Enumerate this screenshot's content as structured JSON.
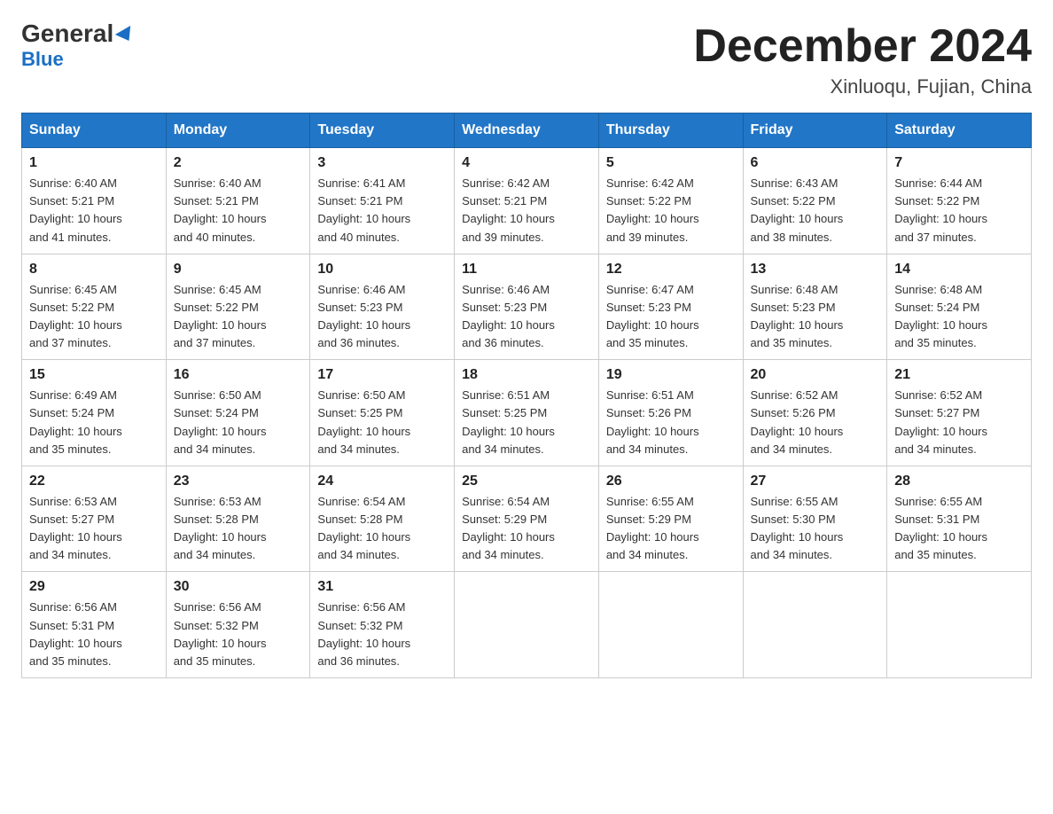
{
  "header": {
    "logo_main": "General",
    "logo_sub": "Blue",
    "month_title": "December 2024",
    "location": "Xinluoqu, Fujian, China"
  },
  "days_of_week": [
    "Sunday",
    "Monday",
    "Tuesday",
    "Wednesday",
    "Thursday",
    "Friday",
    "Saturday"
  ],
  "weeks": [
    [
      {
        "day": "1",
        "sunrise": "6:40 AM",
        "sunset": "5:21 PM",
        "daylight": "10 hours and 41 minutes."
      },
      {
        "day": "2",
        "sunrise": "6:40 AM",
        "sunset": "5:21 PM",
        "daylight": "10 hours and 40 minutes."
      },
      {
        "day": "3",
        "sunrise": "6:41 AM",
        "sunset": "5:21 PM",
        "daylight": "10 hours and 40 minutes."
      },
      {
        "day": "4",
        "sunrise": "6:42 AM",
        "sunset": "5:21 PM",
        "daylight": "10 hours and 39 minutes."
      },
      {
        "day": "5",
        "sunrise": "6:42 AM",
        "sunset": "5:22 PM",
        "daylight": "10 hours and 39 minutes."
      },
      {
        "day": "6",
        "sunrise": "6:43 AM",
        "sunset": "5:22 PM",
        "daylight": "10 hours and 38 minutes."
      },
      {
        "day": "7",
        "sunrise": "6:44 AM",
        "sunset": "5:22 PM",
        "daylight": "10 hours and 37 minutes."
      }
    ],
    [
      {
        "day": "8",
        "sunrise": "6:45 AM",
        "sunset": "5:22 PM",
        "daylight": "10 hours and 37 minutes."
      },
      {
        "day": "9",
        "sunrise": "6:45 AM",
        "sunset": "5:22 PM",
        "daylight": "10 hours and 37 minutes."
      },
      {
        "day": "10",
        "sunrise": "6:46 AM",
        "sunset": "5:23 PM",
        "daylight": "10 hours and 36 minutes."
      },
      {
        "day": "11",
        "sunrise": "6:46 AM",
        "sunset": "5:23 PM",
        "daylight": "10 hours and 36 minutes."
      },
      {
        "day": "12",
        "sunrise": "6:47 AM",
        "sunset": "5:23 PM",
        "daylight": "10 hours and 35 minutes."
      },
      {
        "day": "13",
        "sunrise": "6:48 AM",
        "sunset": "5:23 PM",
        "daylight": "10 hours and 35 minutes."
      },
      {
        "day": "14",
        "sunrise": "6:48 AM",
        "sunset": "5:24 PM",
        "daylight": "10 hours and 35 minutes."
      }
    ],
    [
      {
        "day": "15",
        "sunrise": "6:49 AM",
        "sunset": "5:24 PM",
        "daylight": "10 hours and 35 minutes."
      },
      {
        "day": "16",
        "sunrise": "6:50 AM",
        "sunset": "5:24 PM",
        "daylight": "10 hours and 34 minutes."
      },
      {
        "day": "17",
        "sunrise": "6:50 AM",
        "sunset": "5:25 PM",
        "daylight": "10 hours and 34 minutes."
      },
      {
        "day": "18",
        "sunrise": "6:51 AM",
        "sunset": "5:25 PM",
        "daylight": "10 hours and 34 minutes."
      },
      {
        "day": "19",
        "sunrise": "6:51 AM",
        "sunset": "5:26 PM",
        "daylight": "10 hours and 34 minutes."
      },
      {
        "day": "20",
        "sunrise": "6:52 AM",
        "sunset": "5:26 PM",
        "daylight": "10 hours and 34 minutes."
      },
      {
        "day": "21",
        "sunrise": "6:52 AM",
        "sunset": "5:27 PM",
        "daylight": "10 hours and 34 minutes."
      }
    ],
    [
      {
        "day": "22",
        "sunrise": "6:53 AM",
        "sunset": "5:27 PM",
        "daylight": "10 hours and 34 minutes."
      },
      {
        "day": "23",
        "sunrise": "6:53 AM",
        "sunset": "5:28 PM",
        "daylight": "10 hours and 34 minutes."
      },
      {
        "day": "24",
        "sunrise": "6:54 AM",
        "sunset": "5:28 PM",
        "daylight": "10 hours and 34 minutes."
      },
      {
        "day": "25",
        "sunrise": "6:54 AM",
        "sunset": "5:29 PM",
        "daylight": "10 hours and 34 minutes."
      },
      {
        "day": "26",
        "sunrise": "6:55 AM",
        "sunset": "5:29 PM",
        "daylight": "10 hours and 34 minutes."
      },
      {
        "day": "27",
        "sunrise": "6:55 AM",
        "sunset": "5:30 PM",
        "daylight": "10 hours and 34 minutes."
      },
      {
        "day": "28",
        "sunrise": "6:55 AM",
        "sunset": "5:31 PM",
        "daylight": "10 hours and 35 minutes."
      }
    ],
    [
      {
        "day": "29",
        "sunrise": "6:56 AM",
        "sunset": "5:31 PM",
        "daylight": "10 hours and 35 minutes."
      },
      {
        "day": "30",
        "sunrise": "6:56 AM",
        "sunset": "5:32 PM",
        "daylight": "10 hours and 35 minutes."
      },
      {
        "day": "31",
        "sunrise": "6:56 AM",
        "sunset": "5:32 PM",
        "daylight": "10 hours and 36 minutes."
      },
      null,
      null,
      null,
      null
    ]
  ],
  "labels": {
    "sunrise": "Sunrise:",
    "sunset": "Sunset:",
    "daylight": "Daylight:"
  }
}
